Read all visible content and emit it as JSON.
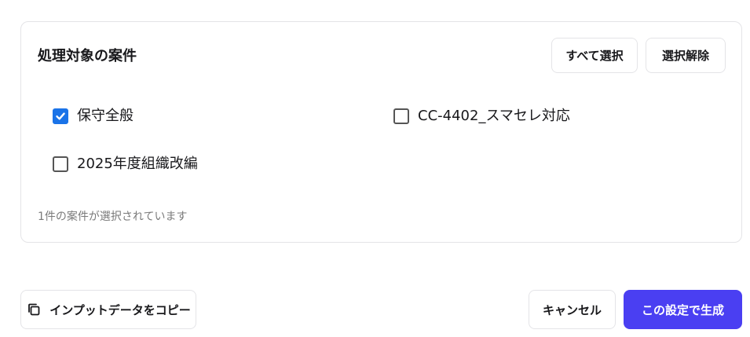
{
  "section": {
    "title": "処理対象の案件",
    "select_all_label": "すべて選択",
    "deselect_all_label": "選択解除"
  },
  "options": [
    {
      "label": "保守全般",
      "checked": true
    },
    {
      "label": "CC-4402_スマセレ対応",
      "checked": false
    },
    {
      "label": "2025年度組織改編",
      "checked": false
    }
  ],
  "selection_status": "1件の案件が選択されています",
  "footer": {
    "copy_label": "インプットデータをコピー",
    "cancel_label": "キャンセル",
    "generate_label": "この設定で生成"
  },
  "colors": {
    "primary": "#4a3ff2",
    "checkbox_checked": "#1a73e8"
  },
  "icons": {
    "copy": "copy-icon",
    "check": "checkmark-icon"
  }
}
